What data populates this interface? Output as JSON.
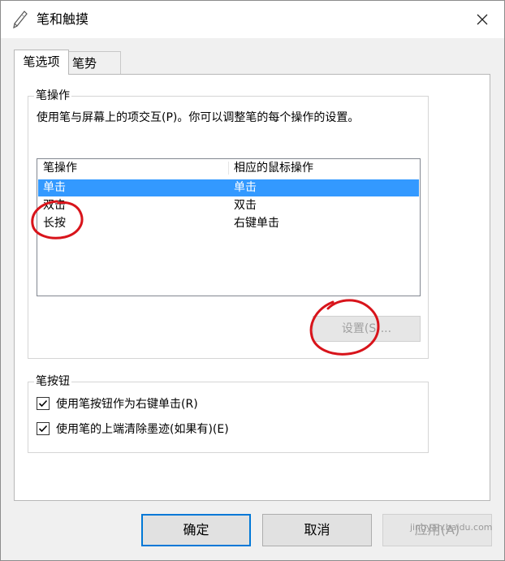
{
  "window": {
    "title": "笔和触摸",
    "close_symbol": "×"
  },
  "tabs": [
    {
      "label": "笔选项",
      "selected": true
    },
    {
      "label": "笔势",
      "selected": false
    }
  ],
  "pen_actions": {
    "group_title": "笔操作",
    "description": "使用笔与屏幕上的项交互(P)。你可以调整笔的每个操作的设置。",
    "columns": [
      "笔操作",
      "相应的鼠标操作"
    ],
    "rows": [
      {
        "action": "单击",
        "mouse": "单击",
        "selected": true
      },
      {
        "action": "双击",
        "mouse": "双击",
        "selected": false
      },
      {
        "action": "长按",
        "mouse": "右键单击",
        "selected": false
      }
    ],
    "settings_button": "设置(S)...",
    "settings_enabled": false
  },
  "pen_buttons": {
    "group_title": "笔按钮",
    "options": [
      {
        "label": "使用笔按钮作为右键单击(R)",
        "checked": true
      },
      {
        "label": "使用笔的上端清除墨迹(如果有)(E)",
        "checked": true
      }
    ]
  },
  "buttons": {
    "ok": "确定",
    "cancel": "取消",
    "apply": "应用(A)"
  },
  "watermark": "jingyan.baidu.com",
  "colors": {
    "selection": "#3399ff",
    "default_button_border": "#0078d7",
    "annotation": "#d8141b"
  },
  "icons": [
    "pen-icon",
    "close-icon",
    "checkbox-checked-icon"
  ]
}
